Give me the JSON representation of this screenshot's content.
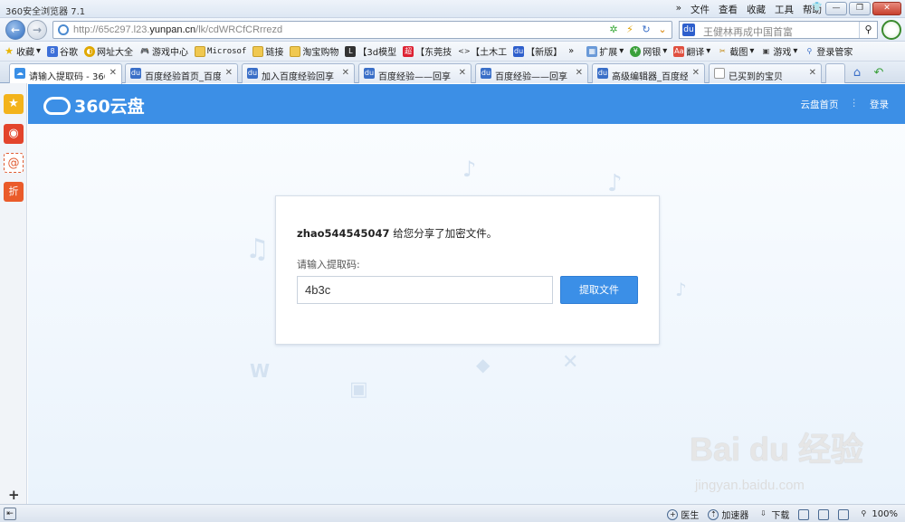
{
  "window": {
    "title": "360安全浏览器 7.1",
    "menu": [
      "»",
      "文件",
      "查看",
      "收藏",
      "工具",
      "帮助"
    ],
    "buttons": {
      "skin": "👕",
      "minimize": "—",
      "maximize": "❐",
      "close": "✕"
    }
  },
  "navbar": {
    "back": "←",
    "forward": "→",
    "url_prefix": "http://65c297.l23.",
    "url_domain": "yunpan.cn",
    "url_suffix": "/lk/cdWRCfCRrrezd",
    "search_query": "王健林再成中国首富",
    "search_engine": "du",
    "search_go": "⚲"
  },
  "favorites": [
    {
      "label": "收藏",
      "icon": "star-icon",
      "arrow": "▾"
    },
    {
      "label": "谷歌",
      "icon": "google-icon"
    },
    {
      "label": "网址大全",
      "icon": "globe-icon"
    },
    {
      "label": "游戏中心",
      "icon": "gamepad-icon"
    },
    {
      "label": "Microsof",
      "icon": "folder-icon"
    },
    {
      "label": "链接",
      "icon": "folder-icon"
    },
    {
      "label": "淘宝购物",
      "icon": "folder-icon"
    },
    {
      "label": "【3d模型",
      "icon": "model-icon"
    },
    {
      "label": "【东莞技",
      "icon": "news-icon"
    },
    {
      "label": "【土木工",
      "icon": "code-icon"
    },
    {
      "label": "【新版】",
      "icon": "paw-icon"
    },
    {
      "label": "»",
      "icon": ""
    },
    {
      "label": "扩展",
      "icon": "grid-icon",
      "arrow": "▾"
    },
    {
      "label": "网银",
      "icon": "yuan-icon",
      "arrow": "▾"
    },
    {
      "label": "翻译",
      "icon": "translate-icon",
      "arrow": "▾"
    },
    {
      "label": "截图",
      "icon": "scissors-icon",
      "arrow": "▾"
    },
    {
      "label": "游戏",
      "icon": "game-icon",
      "arrow": "▾"
    },
    {
      "label": "登录管家",
      "icon": "key-icon"
    }
  ],
  "tabs": [
    {
      "label": "请输入提取码 - 360",
      "active": true
    },
    {
      "label": "百度经验首页_百度",
      "active": false
    },
    {
      "label": "加入百度经验回享",
      "active": false
    },
    {
      "label": "百度经验——回享",
      "active": false
    },
    {
      "label": "百度经验——回享",
      "active": false
    },
    {
      "label": "高级编辑器_百度经",
      "active": false
    },
    {
      "label": "已买到的宝贝",
      "active": false
    }
  ],
  "tab_close": "✕",
  "sidebar": {
    "items": [
      "★",
      "◉",
      "@",
      "折"
    ],
    "add": "+"
  },
  "page": {
    "logo": "360云盘",
    "links": [
      "云盘首页",
      "⋮",
      "登录"
    ],
    "sharer": "zhao544545047",
    "share_text": " 给您分享了加密文件。",
    "prompt": "请输入提取码:",
    "code_value": "4b3c",
    "button": "提取文件"
  },
  "watermark": {
    "brand": "Bai du 经验",
    "domain": "jingyan.baidu.com"
  },
  "statusbar": {
    "items": [
      "医生",
      "加速器",
      "下载",
      "",
      "",
      "",
      "100%"
    ]
  },
  "colors": {
    "header_blue": "#3c8fe6",
    "button_blue": "#3b8fe7",
    "close_red": "#c7402e"
  }
}
